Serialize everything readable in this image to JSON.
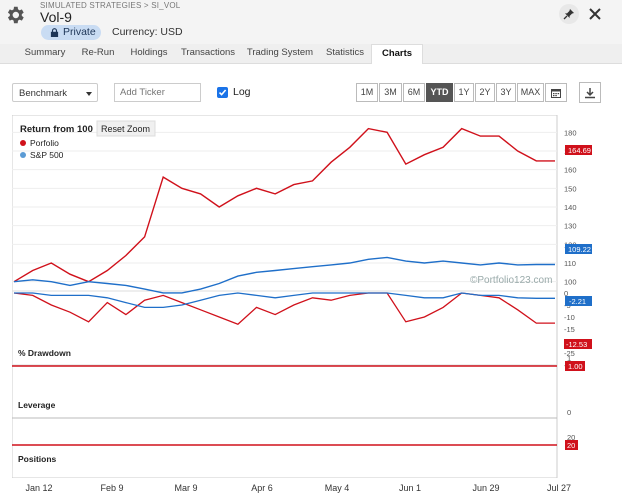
{
  "header": {
    "breadcrumb": "SIMULATED STRATEGIES > SI_VOL",
    "title": "Vol-9",
    "badge": "Private",
    "currency": "Currency: USD",
    "icons": [
      "gear-icon",
      "lock-icon",
      "pin-icon",
      "close-icon"
    ]
  },
  "tabs": [
    {
      "label": "Summary",
      "active": false
    },
    {
      "label": "Re-Run",
      "active": false
    },
    {
      "label": "Holdings",
      "active": false
    },
    {
      "label": "Transactions",
      "active": false
    },
    {
      "label": "Trading System",
      "active": false
    },
    {
      "label": "Statistics",
      "active": false
    },
    {
      "label": "Charts",
      "active": true
    }
  ],
  "toolbar": {
    "benchmark": "Benchmark",
    "ticker_placeholder": "Add Ticker",
    "log_label": "Log",
    "log_checked": true,
    "ranges": [
      "1M",
      "3M",
      "6M",
      "YTD",
      "1Y",
      "2Y",
      "3Y",
      "MAX"
    ],
    "active_range": "YTD"
  },
  "chart": {
    "title": "Return from 100",
    "reset_zoom": "Reset Zoom",
    "watermark": "©Portfolio123.com",
    "legend": [
      {
        "name": "Porfolio",
        "color": "#d0111b"
      },
      {
        "name": "S&P 500",
        "color": "#5b9bd5"
      }
    ],
    "panes": {
      "drawdown": "% Drawdown",
      "leverage": "Leverage",
      "positions": "Positions"
    },
    "end_badges": {
      "portfolio": "164.69",
      "sp500": "109.22",
      "dd_portfolio": "-12.53",
      "dd_sp500": "-2.21",
      "leverage": "1.00",
      "positions": "20"
    },
    "main_ticks": [
      "180",
      "170",
      "160",
      "150",
      "140",
      "130",
      "120",
      "110",
      "100"
    ],
    "dd_ticks": [
      "0",
      "-5",
      "-10",
      "-15",
      "-20",
      "-25",
      "-30"
    ],
    "lev_ticks": [
      "1",
      "0"
    ],
    "pos_ticks": [
      "20"
    ],
    "x_ticks": [
      "Jan 12",
      "Feb 9",
      "Mar 9",
      "Apr 6",
      "May 4",
      "Jun 1",
      "Jun 29",
      "Jul 27"
    ]
  },
  "chart_data": {
    "type": "line",
    "x": [
      "Jan 12",
      "Jan 19",
      "Jan 26",
      "Feb 2",
      "Feb 9",
      "Feb 16",
      "Feb 23",
      "Mar 2",
      "Mar 9",
      "Mar 16",
      "Mar 23",
      "Mar 30",
      "Apr 6",
      "Apr 13",
      "Apr 20",
      "Apr 27",
      "May 4",
      "May 11",
      "May 18",
      "May 25",
      "Jun 1",
      "Jun 8",
      "Jun 15",
      "Jun 22",
      "Jun 29",
      "Jul 6",
      "Jul 13",
      "Jul 20",
      "Jul 27",
      "Aug 3"
    ],
    "series": [
      {
        "name": "Porfolio",
        "values": [
          100,
          106,
          110,
          104,
          100,
          106,
          114,
          124,
          156,
          150,
          147,
          140,
          146,
          150,
          147,
          152,
          154,
          164,
          172,
          182,
          180,
          163,
          168,
          172,
          182,
          178,
          178,
          170,
          164.69,
          164.69
        ]
      },
      {
        "name": "S&P 500",
        "values": [
          100,
          101,
          100,
          98,
          100,
          99,
          98,
          96,
          94,
          94,
          96,
          99,
          103,
          105,
          106,
          107,
          108,
          109,
          110,
          112,
          113,
          111,
          110,
          111,
          110,
          109,
          110,
          109,
          109.22,
          109.22
        ]
      }
    ],
    "drawdown": [
      {
        "name": "Porfolio",
        "values": [
          0,
          -1,
          -5,
          -8,
          -12,
          -4,
          -9,
          -3,
          -1,
          -4,
          -7,
          -10,
          -13,
          -6,
          -9,
          -5,
          -2,
          -3,
          -1,
          0,
          0,
          -12,
          -10,
          -6,
          0,
          -1,
          -2,
          -7,
          -12.53,
          -12.53
        ]
      },
      {
        "name": "S&P 500",
        "values": [
          0,
          0,
          -1,
          -1,
          -1,
          -2,
          -4,
          -6,
          -6,
          -5,
          -3,
          -1,
          0,
          -1,
          -2,
          -1,
          0,
          0,
          0,
          0,
          0,
          -1,
          -2,
          -2,
          0,
          -1,
          -1,
          -2,
          -2.21,
          -2.21
        ]
      }
    ],
    "leverage": 1.0,
    "positions": 20,
    "log_scale": true,
    "ylim": [
      95,
      185
    ],
    "dd_ylim": [
      -30,
      0
    ]
  }
}
